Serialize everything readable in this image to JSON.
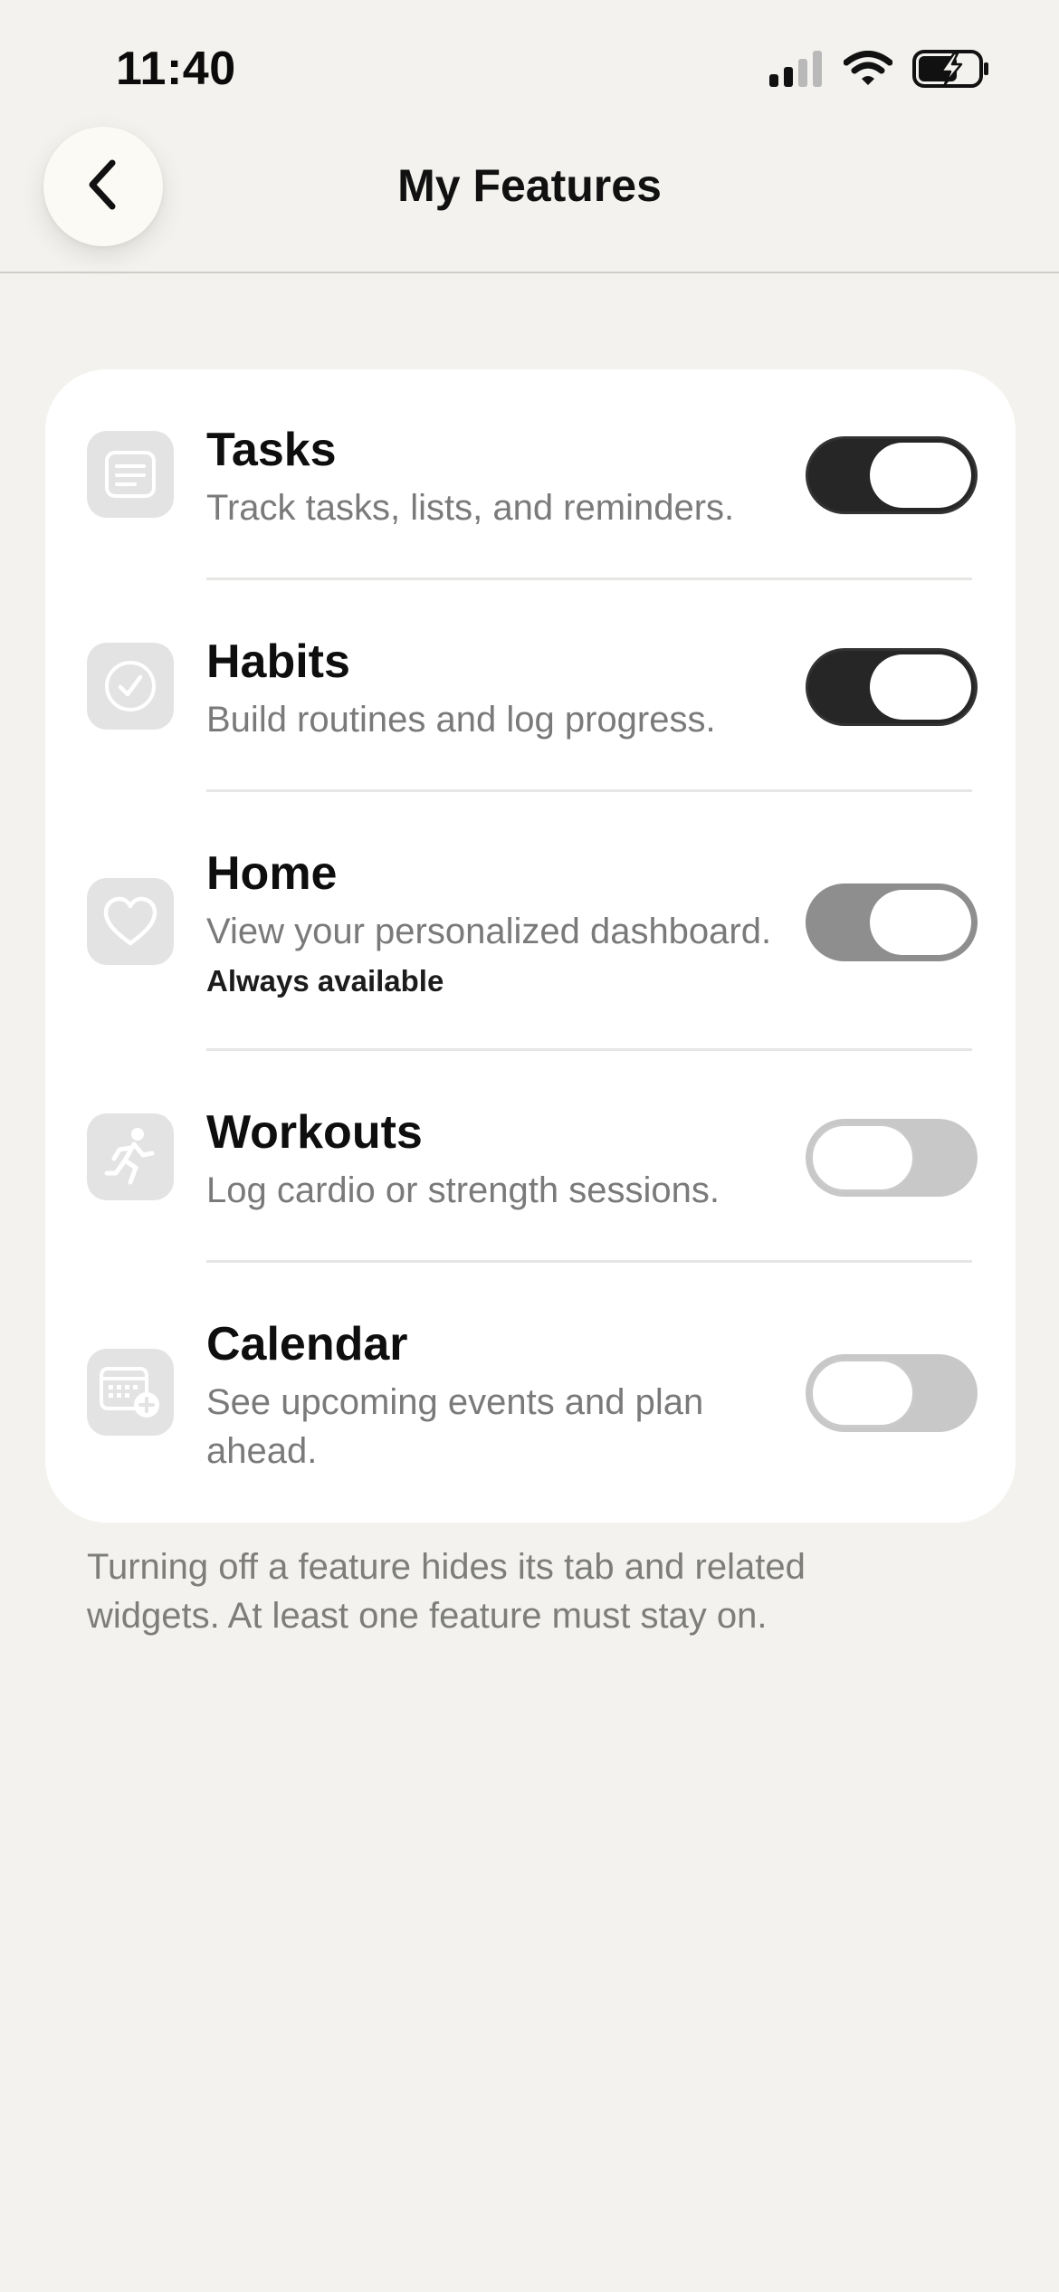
{
  "status_bar": {
    "time": "11:40",
    "icons": [
      "cellular-signal-icon",
      "wifi-icon",
      "battery-charging-icon"
    ]
  },
  "nav": {
    "title": "My Features",
    "back_icon": "chevron-left-icon"
  },
  "features": [
    {
      "title": "Tasks",
      "description": "Track tasks, lists, and reminders.",
      "note": "",
      "icon": "list-document-icon",
      "enabled": true,
      "locked": false
    },
    {
      "title": "Habits",
      "description": "Build routines and log progress.",
      "note": "",
      "icon": "checkmark-circle-icon",
      "enabled": true,
      "locked": false
    },
    {
      "title": "Home",
      "description": "View your personalized dashboard.",
      "note": "Always available",
      "icon": "heart-icon",
      "enabled": true,
      "locked": true
    },
    {
      "title": "Workouts",
      "description": "Log cardio or strength sessions.",
      "note": "",
      "icon": "running-figure-icon",
      "enabled": false,
      "locked": false
    },
    {
      "title": "Calendar",
      "description": "See upcoming events and plan ahead.",
      "note": "",
      "icon": "calendar-add-icon",
      "enabled": false,
      "locked": false
    }
  ],
  "footer": {
    "note": "Turning off a feature hides its tab and related widgets. At least one feature must stay on."
  },
  "colors": {
    "background": "#f3f2ee",
    "card": "#ffffff",
    "toggle_on": "#262626",
    "toggle_locked": "#8e8e8e",
    "toggle_off": "#c8c8c9",
    "icon_tile": "#e3e3e3"
  }
}
